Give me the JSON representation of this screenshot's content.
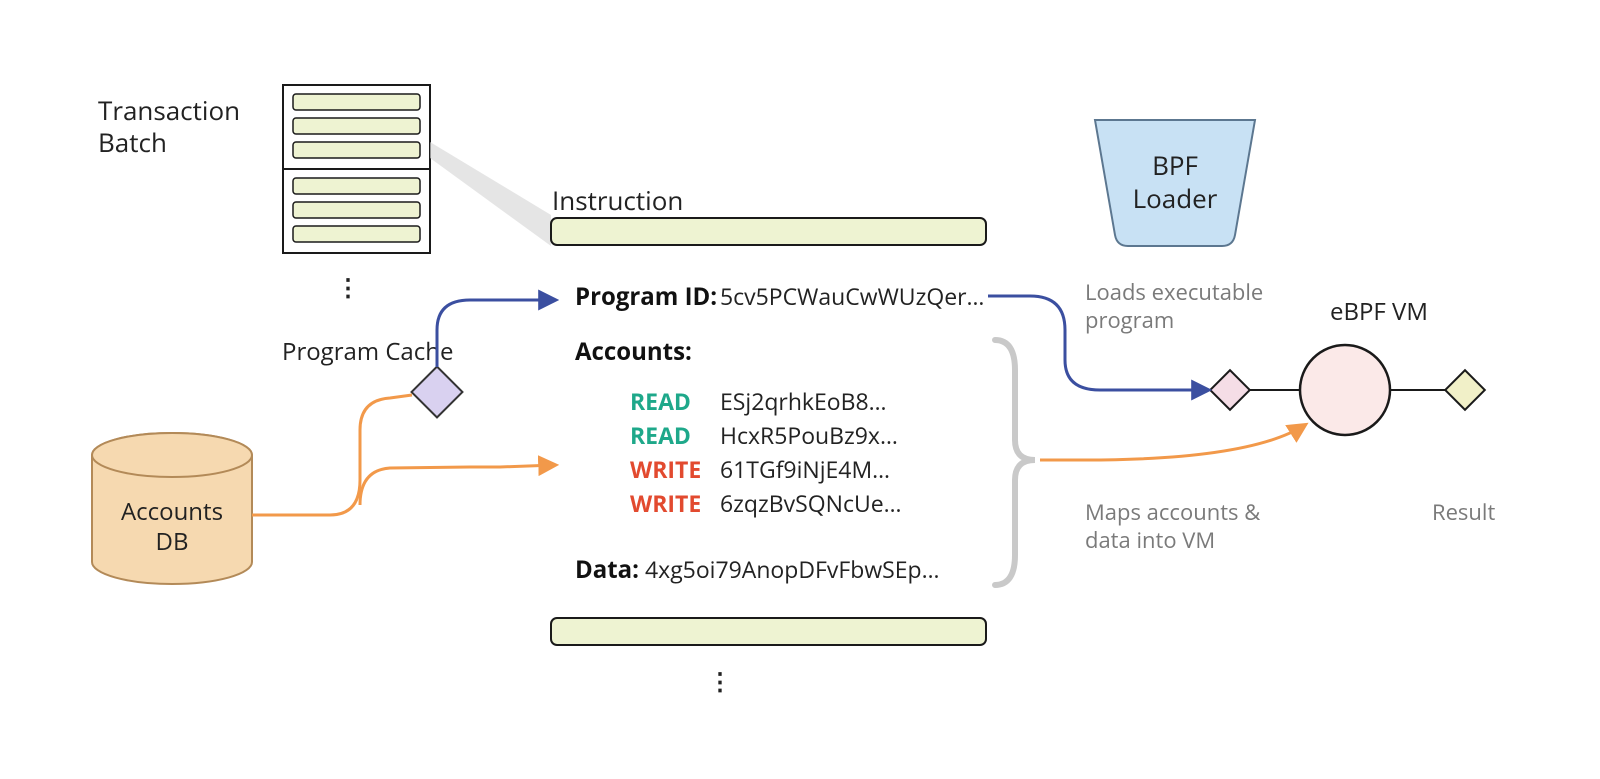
{
  "labels": {
    "transaction_batch_l1": "Transaction",
    "transaction_batch_l2": "Batch",
    "program_cache": "Program Cache",
    "accounts_db_l1": "Accounts",
    "accounts_db_l2": "DB",
    "instruction": "Instruction",
    "program_id_label": "Program ID:",
    "program_id_value": "5cv5PCWauCwWUzQer…",
    "accounts_label": "Accounts:",
    "accounts": {
      "r1": {
        "mode": "READ",
        "key": "ESj2qrhkEoB8…"
      },
      "r2": {
        "mode": "READ",
        "key": "HcxR5PouBz9x…"
      },
      "w1": {
        "mode": "WRITE",
        "key": "61TGf9iNjE4M…"
      },
      "w2": {
        "mode": "WRITE",
        "key": "6zqzBvSQNcUe…"
      }
    },
    "data_label": "Data:",
    "data_value": "4xg5oi79AnopDFvFbwSEp…",
    "bpf_loader_l1": "BPF",
    "bpf_loader_l2": "Loader",
    "ebpf_vm": "eBPF VM",
    "loads_exec_l1": "Loads executable",
    "loads_exec_l2": "program",
    "maps_l1": "Maps accounts &",
    "maps_l2": "data into VM",
    "result": "Result",
    "ellipsis": "⋮"
  },
  "colors": {
    "bar_fill": "#eef3d2",
    "bar_stroke": "#1a1a1a",
    "db_fill": "#f6d9b0",
    "db_stroke": "#b38a58",
    "cache_fill": "#d9d1f0",
    "cache_stroke": "#333",
    "loader_fill": "#c8e1f4",
    "loader_stroke": "#5c7790",
    "vm_fill": "#fbe9e8",
    "vm_stroke": "#1a1a1a",
    "arrow_orange": "#f2994a",
    "arrow_blue": "#3b4fa0",
    "light_gray": "#c9c9c9",
    "read": "#1ea88a",
    "write": "#e24a2f",
    "dia_pink": "#f5dde6",
    "dia_yellow": "#f1f0c8"
  }
}
